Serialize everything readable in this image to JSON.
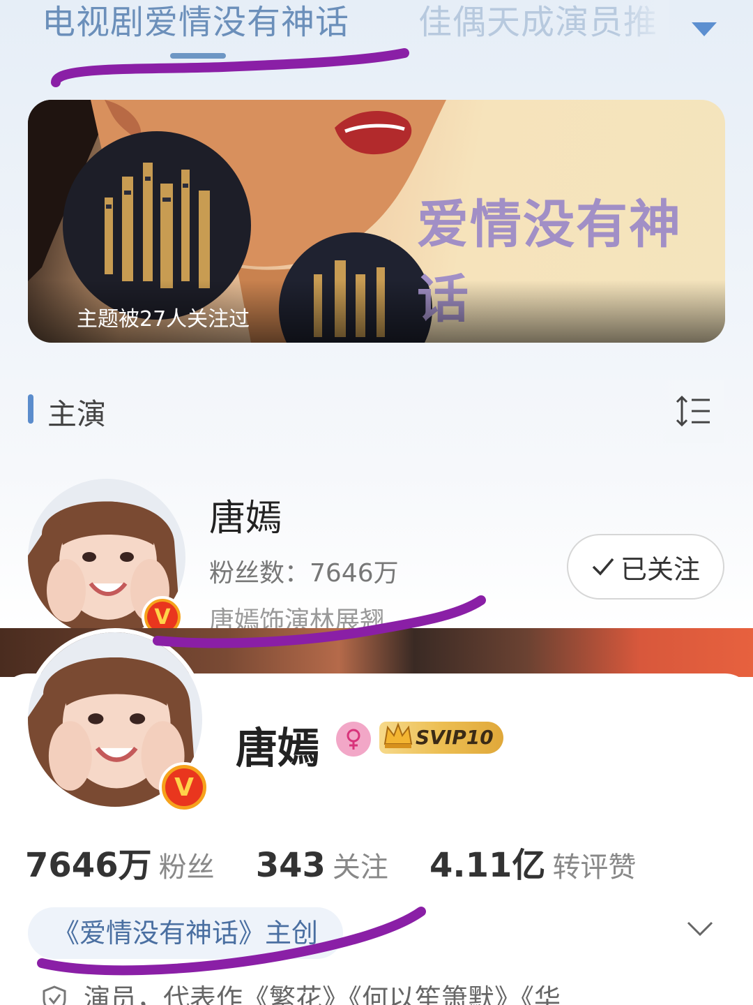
{
  "tabs": {
    "active": "电视剧爱情没有神话",
    "inactive": "佳偶天成演员推"
  },
  "banner": {
    "title": "爱情没有神话",
    "followers": "主题被27人关注过"
  },
  "section": {
    "title": "主演"
  },
  "actor": {
    "name": "唐嫣",
    "fans": "粉丝数：7646万",
    "role": "唐嫣饰演林展翘",
    "follow_label": "已关注",
    "verified_badge": "V"
  },
  "profile": {
    "name": "唐嫣",
    "svip": "SVIP10",
    "stats": [
      {
        "num": "7646万",
        "label": "粉丝"
      },
      {
        "num": "343",
        "label": "关注"
      },
      {
        "num": "4.11亿",
        "label": "转评赞"
      }
    ],
    "tag": "《爱情没有神话》主创",
    "description": "演员，代表作《繁花》《何以笙箫默》《华"
  },
  "colors": {
    "accent": "#6b8fba",
    "annotation": "#8a1fa6",
    "verified": "#f6a21c"
  },
  "icons": [
    "chevron-down-icon",
    "sort-icon",
    "check-icon",
    "female-icon",
    "crown-icon",
    "shield-icon"
  ]
}
